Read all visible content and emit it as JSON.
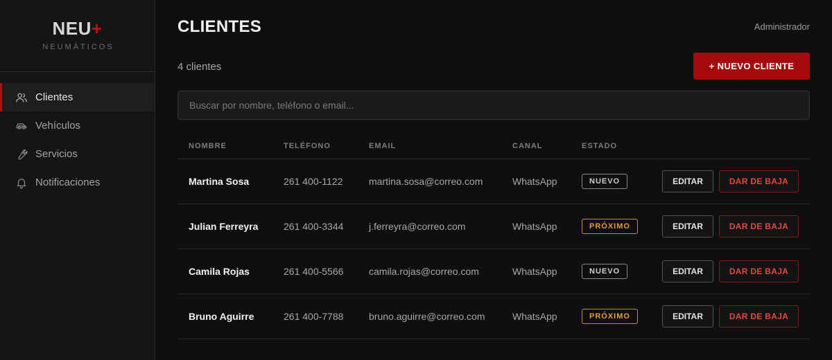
{
  "brand": {
    "name": "NEU",
    "plus": "+",
    "subtitle": "NEUMÁTICOS"
  },
  "sidebar": {
    "items": [
      {
        "label": "Clientes",
        "icon": "users-icon",
        "active": true
      },
      {
        "label": "Vehículos",
        "icon": "car-icon",
        "active": false
      },
      {
        "label": "Servicios",
        "icon": "wrench-icon",
        "active": false
      },
      {
        "label": "Notificaciones",
        "icon": "bell-icon",
        "active": false
      }
    ]
  },
  "header": {
    "title": "CLIENTES",
    "user_role": "Administrador"
  },
  "toolbar": {
    "count_text": "4 clientes",
    "new_button_label": "+ NUEVO CLIENTE"
  },
  "search": {
    "placeholder": "Buscar por nombre, teléfono o email...",
    "value": ""
  },
  "table": {
    "columns": [
      "NOMBRE",
      "TELÉFONO",
      "EMAIL",
      "CANAL",
      "ESTADO"
    ],
    "edit_label": "EDITAR",
    "delete_label": "DAR DE BAJA",
    "rows": [
      {
        "name": "Martina Sosa",
        "phone": "261 400-1122",
        "email": "martina.sosa@correo.com",
        "channel": "WhatsApp",
        "status": "NUEVO"
      },
      {
        "name": "Julian Ferreyra",
        "phone": "261 400-3344",
        "email": "j.ferreyra@correo.com",
        "channel": "WhatsApp",
        "status": "PRÓXIMO"
      },
      {
        "name": "Camila Rojas",
        "phone": "261 400-5566",
        "email": "camila.rojas@correo.com",
        "channel": "WhatsApp",
        "status": "NUEVO"
      },
      {
        "name": "Bruno Aguirre",
        "phone": "261 400-7788",
        "email": "bruno.aguirre@correo.com",
        "channel": "WhatsApp",
        "status": "PRÓXIMO"
      }
    ]
  },
  "colors": {
    "accent": "#a50b0b",
    "status_nuevo": "#cfcfcf",
    "status_proximo": "#e89a3a",
    "danger": "#e6473f"
  }
}
